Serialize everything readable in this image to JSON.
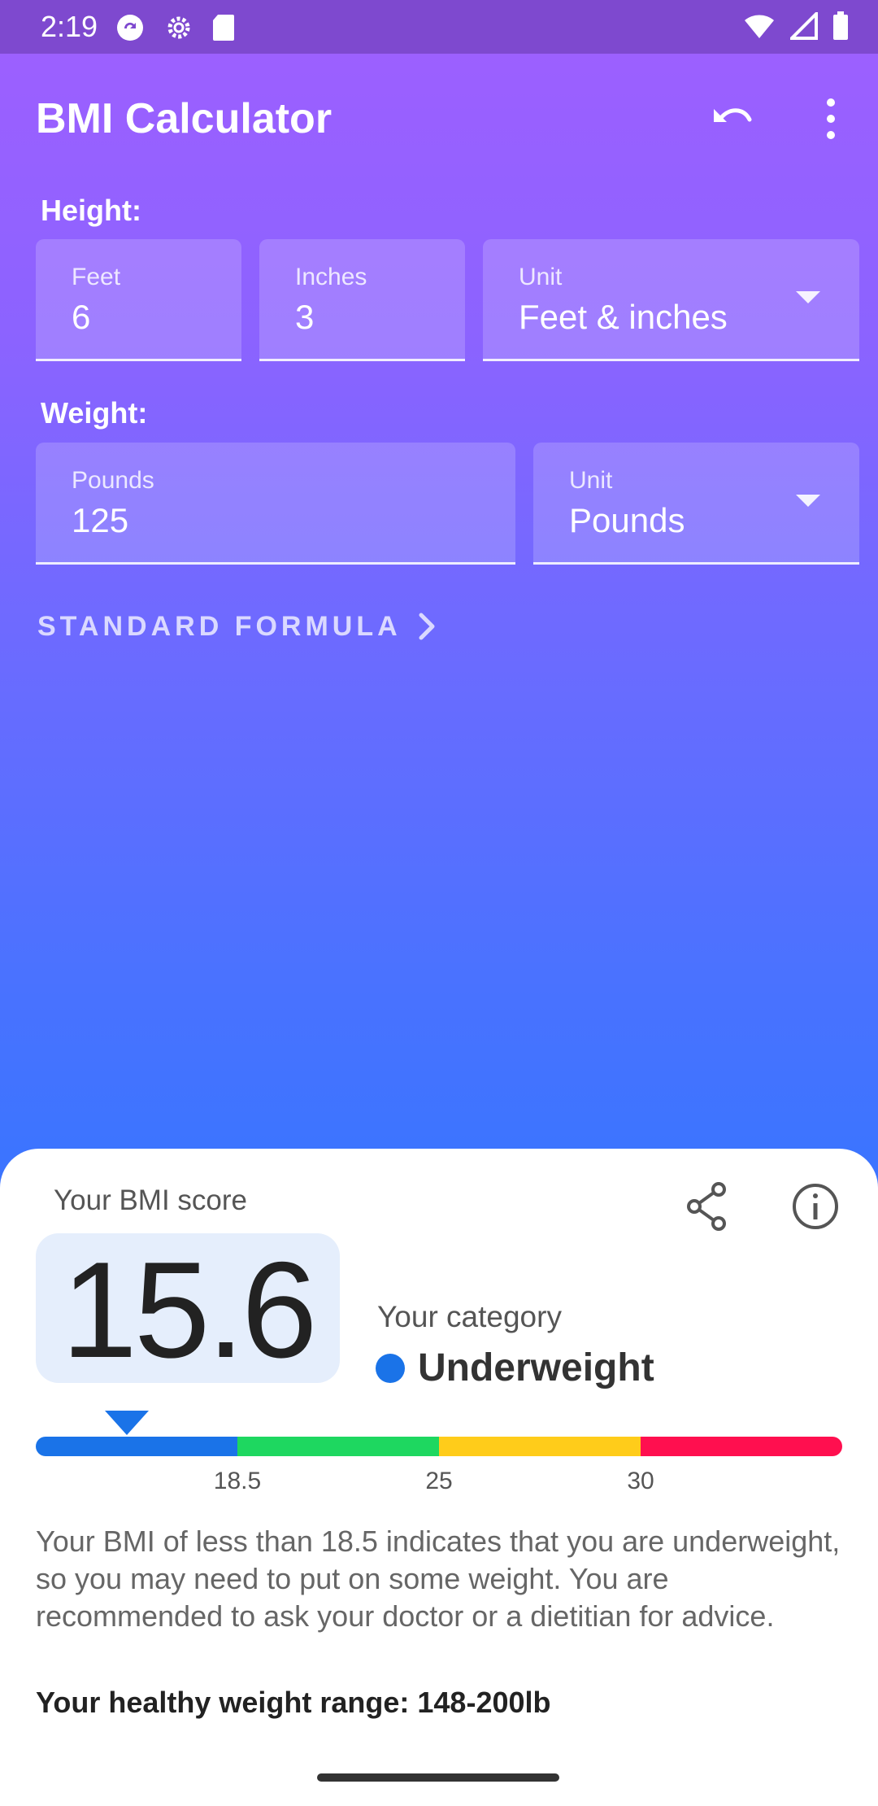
{
  "status_bar": {
    "time": "2:19"
  },
  "app_bar": {
    "title": "BMI Calculator",
    "undo_icon": "undo-icon",
    "more_icon": "more-vert-icon"
  },
  "height": {
    "section_label": "Height:",
    "feet": {
      "label": "Feet",
      "value": "6"
    },
    "inches": {
      "label": "Inches",
      "value": "3"
    },
    "unit": {
      "label": "Unit",
      "value": "Feet & inches"
    }
  },
  "weight": {
    "section_label": "Weight:",
    "pounds": {
      "label": "Pounds",
      "value": "125"
    },
    "unit": {
      "label": "Unit",
      "value": "Pounds"
    }
  },
  "formula": {
    "label": "STANDARD FORMULA"
  },
  "result": {
    "score_label": "Your BMI score",
    "score": "15.6",
    "category_label": "Your category",
    "category": "Underweight",
    "category_color": "#1A73E8",
    "scale": {
      "marker_value": 15.6,
      "ticks": [
        "18.5",
        "25",
        "30"
      ],
      "segments": [
        {
          "color": "#1A73E8"
        },
        {
          "color": "#1ED760"
        },
        {
          "color": "#FFCC1A"
        },
        {
          "color": "#FF0F4F"
        }
      ]
    },
    "description": "Your BMI of less than 18.5 indicates that you are underweight, so you may need to put on some weight. You are recommended to ask your doctor or a dietitian for advice.",
    "healthy_range": "Your healthy weight range: 148-200lb",
    "share_icon": "share-icon",
    "info_icon": "info-icon"
  }
}
